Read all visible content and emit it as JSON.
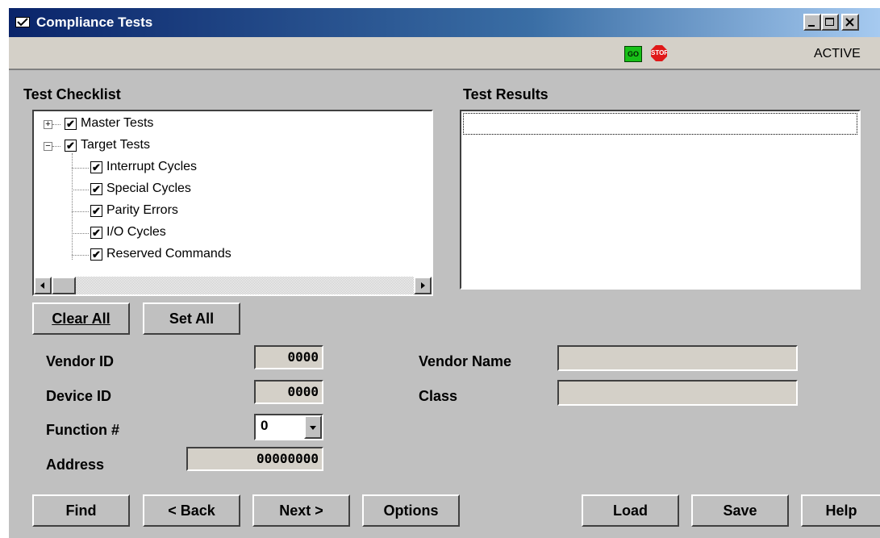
{
  "window": {
    "title": "Compliance Tests",
    "status": "ACTIVE",
    "go_label": "GO",
    "stop_label": "STOP"
  },
  "checklist": {
    "heading": "Test Checklist",
    "items": [
      {
        "label": "Master Tests",
        "checked": true,
        "expander": "+"
      },
      {
        "label": "Target Tests",
        "checked": true,
        "expander": "−"
      },
      {
        "label": "Interrupt Cycles",
        "checked": true
      },
      {
        "label": "Special Cycles",
        "checked": true
      },
      {
        "label": "Parity Errors",
        "checked": true
      },
      {
        "label": "I/O Cycles",
        "checked": true
      },
      {
        "label": "Reserved Commands",
        "checked": true
      }
    ]
  },
  "results": {
    "heading": "Test Results"
  },
  "buttons": {
    "clear_all": "Clear All",
    "set_all": "Set All",
    "find": "Find",
    "back": "< Back",
    "next": "Next >",
    "options": "Options",
    "load": "Load",
    "save": "Save",
    "help": "Help"
  },
  "fields": {
    "vendor_id_label": "Vendor ID",
    "vendor_id": "0000",
    "device_id_label": "Device ID",
    "device_id": "0000",
    "function_label": "Function #",
    "function_value": "0",
    "address_label": "Address",
    "address": "00000000",
    "vendor_name_label": "Vendor Name",
    "vendor_name": "",
    "class_label": "Class",
    "class_value": ""
  },
  "colors": {
    "face": "#c0c0c0",
    "title_start": "#0a246a",
    "title_end": "#a6caf0",
    "go": "#18c018",
    "stop": "#e01818"
  }
}
